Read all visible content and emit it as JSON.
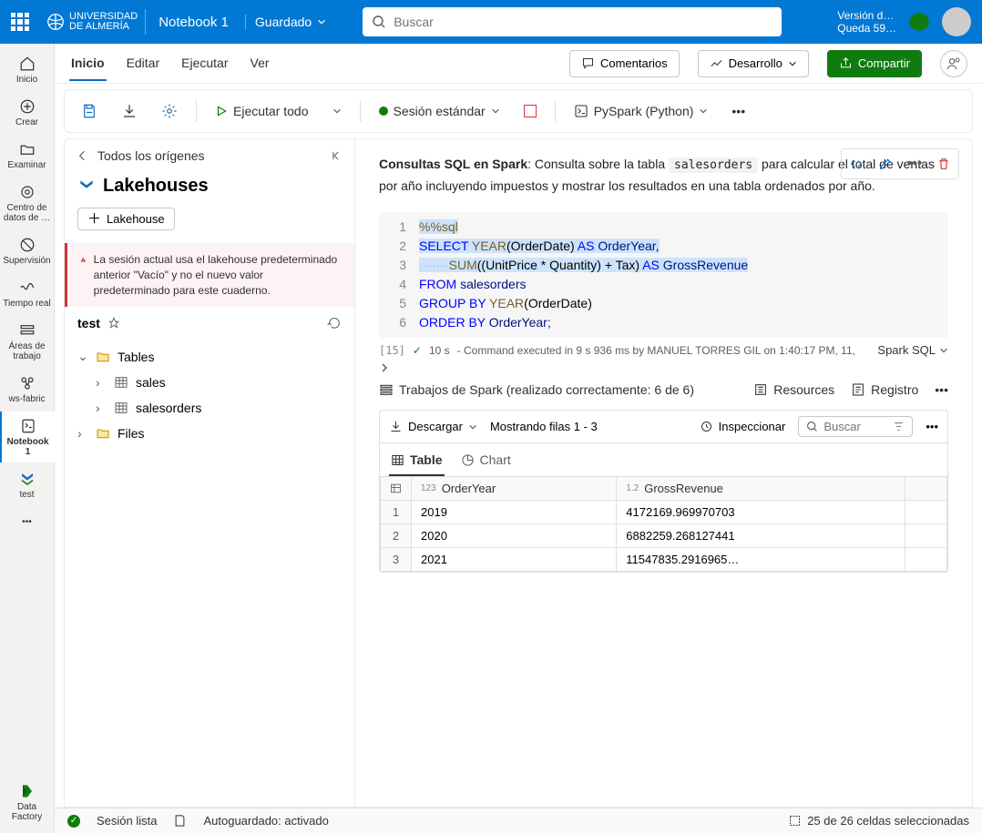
{
  "topbar": {
    "org1": "UNIVERSIDAD",
    "org2": "DE ALMERÍA",
    "doc_title": "Notebook 1",
    "saved": "Guardado",
    "search_placeholder": "Buscar",
    "trial1": "Versión d…",
    "trial2": "Queda 59…"
  },
  "leftrail": {
    "home": "Inicio",
    "create": "Crear",
    "browse": "Examinar",
    "onelake": "Centro de datos de …",
    "monitor": "Supervisión",
    "realtime": "Tiempo real",
    "workspaces": "Áreas de trabajo",
    "wsfabric": "ws-fabric",
    "notebook": "Notebook 1",
    "test": "test",
    "bottom": "Data Factory"
  },
  "tabs": {
    "home": "Inicio",
    "edit": "Editar",
    "run": "Ejecutar",
    "view": "Ver",
    "comments": "Comentarios",
    "develop": "Desarrollo",
    "share": "Compartir"
  },
  "toolbar": {
    "run_all": "Ejecutar todo",
    "session": "Sesión estándar",
    "kernel": "PySpark (Python)"
  },
  "explorer": {
    "back": "Todos los orígenes",
    "title": "Lakehouses",
    "add_btn": "Lakehouse",
    "warn": "La sesión actual usa el lakehouse predeterminado anterior \"Vacío\" y no el nuevo valor predeterminado para este cuaderno.",
    "lakehouse_name": "test",
    "tables": "Tables",
    "files": "Files",
    "table_items": [
      "sales",
      "salesorders"
    ]
  },
  "cell": {
    "md_bold": "Consultas SQL en Spark",
    "md_rest1": ": Consulta sobre la tabla ",
    "md_code": "salesorders",
    "md_rest2": " para calcular el total de ventas por año incluyendo impuestos y mostrar los resultados en una tabla ordenados por año.",
    "exec_idx": "[15]",
    "exec_time": "10 s",
    "exec_msg": "- Command executed in 9 s 936 ms by MANUEL TORRES GIL on 1:40:17 PM, 11,",
    "lang": "Spark SQL",
    "code": {
      "l1": "%%sql",
      "l2a": "SELECT ",
      "l2b": "YEAR",
      "l2c": "(OrderDate) ",
      "l2d": "AS ",
      "l2e": "OrderYear,",
      "l3a": "       ",
      "l3b": "SUM",
      "l3c": "((UnitPrice ",
      "l3d": "* ",
      "l3e": "Quantity) ",
      "l3f": "+ ",
      "l3g": "Tax) ",
      "l3h": "AS ",
      "l3i": "GrossRevenue",
      "l4a": "FROM ",
      "l4b": "salesorders",
      "l5a": "GROUP BY ",
      "l5b": "YEAR",
      "l5c": "(OrderDate)",
      "l6a": "ORDER BY ",
      "l6b": "OrderYear;"
    }
  },
  "output": {
    "jobs": "Trabajos de Spark (realizado correctamente: 6 de 6)",
    "resources": "Resources",
    "log": "Registro",
    "download": "Descargar",
    "rows_showing": "Mostrando filas 1 - 3",
    "inspect": "Inspeccionar",
    "search_placeholder": "Buscar",
    "tab_table": "Table",
    "tab_chart": "Chart",
    "columns": [
      {
        "dtype": "123",
        "name": "OrderYear"
      },
      {
        "dtype": "1.2",
        "name": "GrossRevenue"
      }
    ],
    "rows": [
      {
        "i": "1",
        "y": "2019",
        "r": "4172169.969970703"
      },
      {
        "i": "2",
        "y": "2020",
        "r": "6882259.268127441"
      },
      {
        "i": "3",
        "y": "2021",
        "r": "11547835.2916965…"
      }
    ]
  },
  "status": {
    "session": "Sesión lista",
    "autosave": "Autoguardado: activado",
    "cells": "25 de 26 celdas seleccionadas"
  }
}
